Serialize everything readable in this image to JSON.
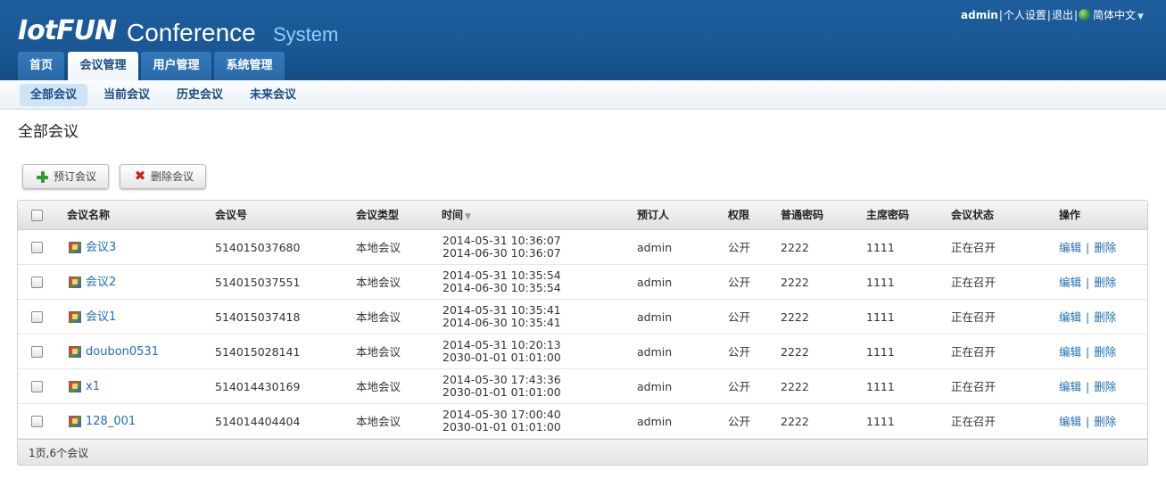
{
  "header": {
    "logo": "IotFUN",
    "title_conference": "Conference",
    "title_system": "System",
    "user": {
      "name": "admin",
      "settings_label": "个人设置",
      "logout_label": "退出",
      "language_label": "简体中文"
    }
  },
  "main_tabs": [
    {
      "label": "首页",
      "active": false
    },
    {
      "label": "会议管理",
      "active": true
    },
    {
      "label": "用户管理",
      "active": false
    },
    {
      "label": "系统管理",
      "active": false
    }
  ],
  "sub_tabs": [
    {
      "label": "全部会议",
      "active": true
    },
    {
      "label": "当前会议",
      "active": false
    },
    {
      "label": "历史会议",
      "active": false
    },
    {
      "label": "未来会议",
      "active": false
    }
  ],
  "page_title": "全部会议",
  "toolbar": {
    "book_label": "预订会议",
    "delete_label": "删除会议"
  },
  "table": {
    "columns": [
      "会议名称",
      "会议号",
      "会议类型",
      "时间",
      "预订人",
      "权限",
      "普通密码",
      "主席密码",
      "会议状态",
      "操作"
    ],
    "sort_indicator": "▼",
    "edit_label": "编辑",
    "delete_label": "删除",
    "op_separator": "|",
    "rows": [
      {
        "name": "会议3",
        "number": "514015037680",
        "type": "本地会议",
        "start": "2014-05-31 10:36:07",
        "end": "2014-06-30 10:36:07",
        "booker": "admin",
        "permission": "公开",
        "normal_pwd": "2222",
        "chair_pwd": "1111",
        "status": "正在召开"
      },
      {
        "name": "会议2",
        "number": "514015037551",
        "type": "本地会议",
        "start": "2014-05-31 10:35:54",
        "end": "2014-06-30 10:35:54",
        "booker": "admin",
        "permission": "公开",
        "normal_pwd": "2222",
        "chair_pwd": "1111",
        "status": "正在召开"
      },
      {
        "name": "会议1",
        "number": "514015037418",
        "type": "本地会议",
        "start": "2014-05-31 10:35:41",
        "end": "2014-06-30 10:35:41",
        "booker": "admin",
        "permission": "公开",
        "normal_pwd": "2222",
        "chair_pwd": "1111",
        "status": "正在召开"
      },
      {
        "name": "doubon0531",
        "number": "514015028141",
        "type": "本地会议",
        "start": "2014-05-31 10:20:13",
        "end": "2030-01-01 01:01:00",
        "booker": "admin",
        "permission": "公开",
        "normal_pwd": "2222",
        "chair_pwd": "1111",
        "status": "正在召开"
      },
      {
        "name": "x1",
        "number": "514014430169",
        "type": "本地会议",
        "start": "2014-05-30 17:43:36",
        "end": "2030-01-01 01:01:00",
        "booker": "admin",
        "permission": "公开",
        "normal_pwd": "2222",
        "chair_pwd": "1111",
        "status": "正在召开"
      },
      {
        "name": "128_001",
        "number": "514014404404",
        "type": "本地会议",
        "start": "2014-05-30 17:00:40",
        "end": "2030-01-01 01:01:00",
        "booker": "admin",
        "permission": "公开",
        "normal_pwd": "2222",
        "chair_pwd": "1111",
        "status": "正在召开"
      }
    ]
  },
  "footer": {
    "summary": "1页,6个会议"
  },
  "colors": {
    "header_blue": "#1a5896",
    "link_blue": "#1f6eb5",
    "system_text": "#8fd0ff",
    "subnav_active": "#cfe4f5"
  }
}
